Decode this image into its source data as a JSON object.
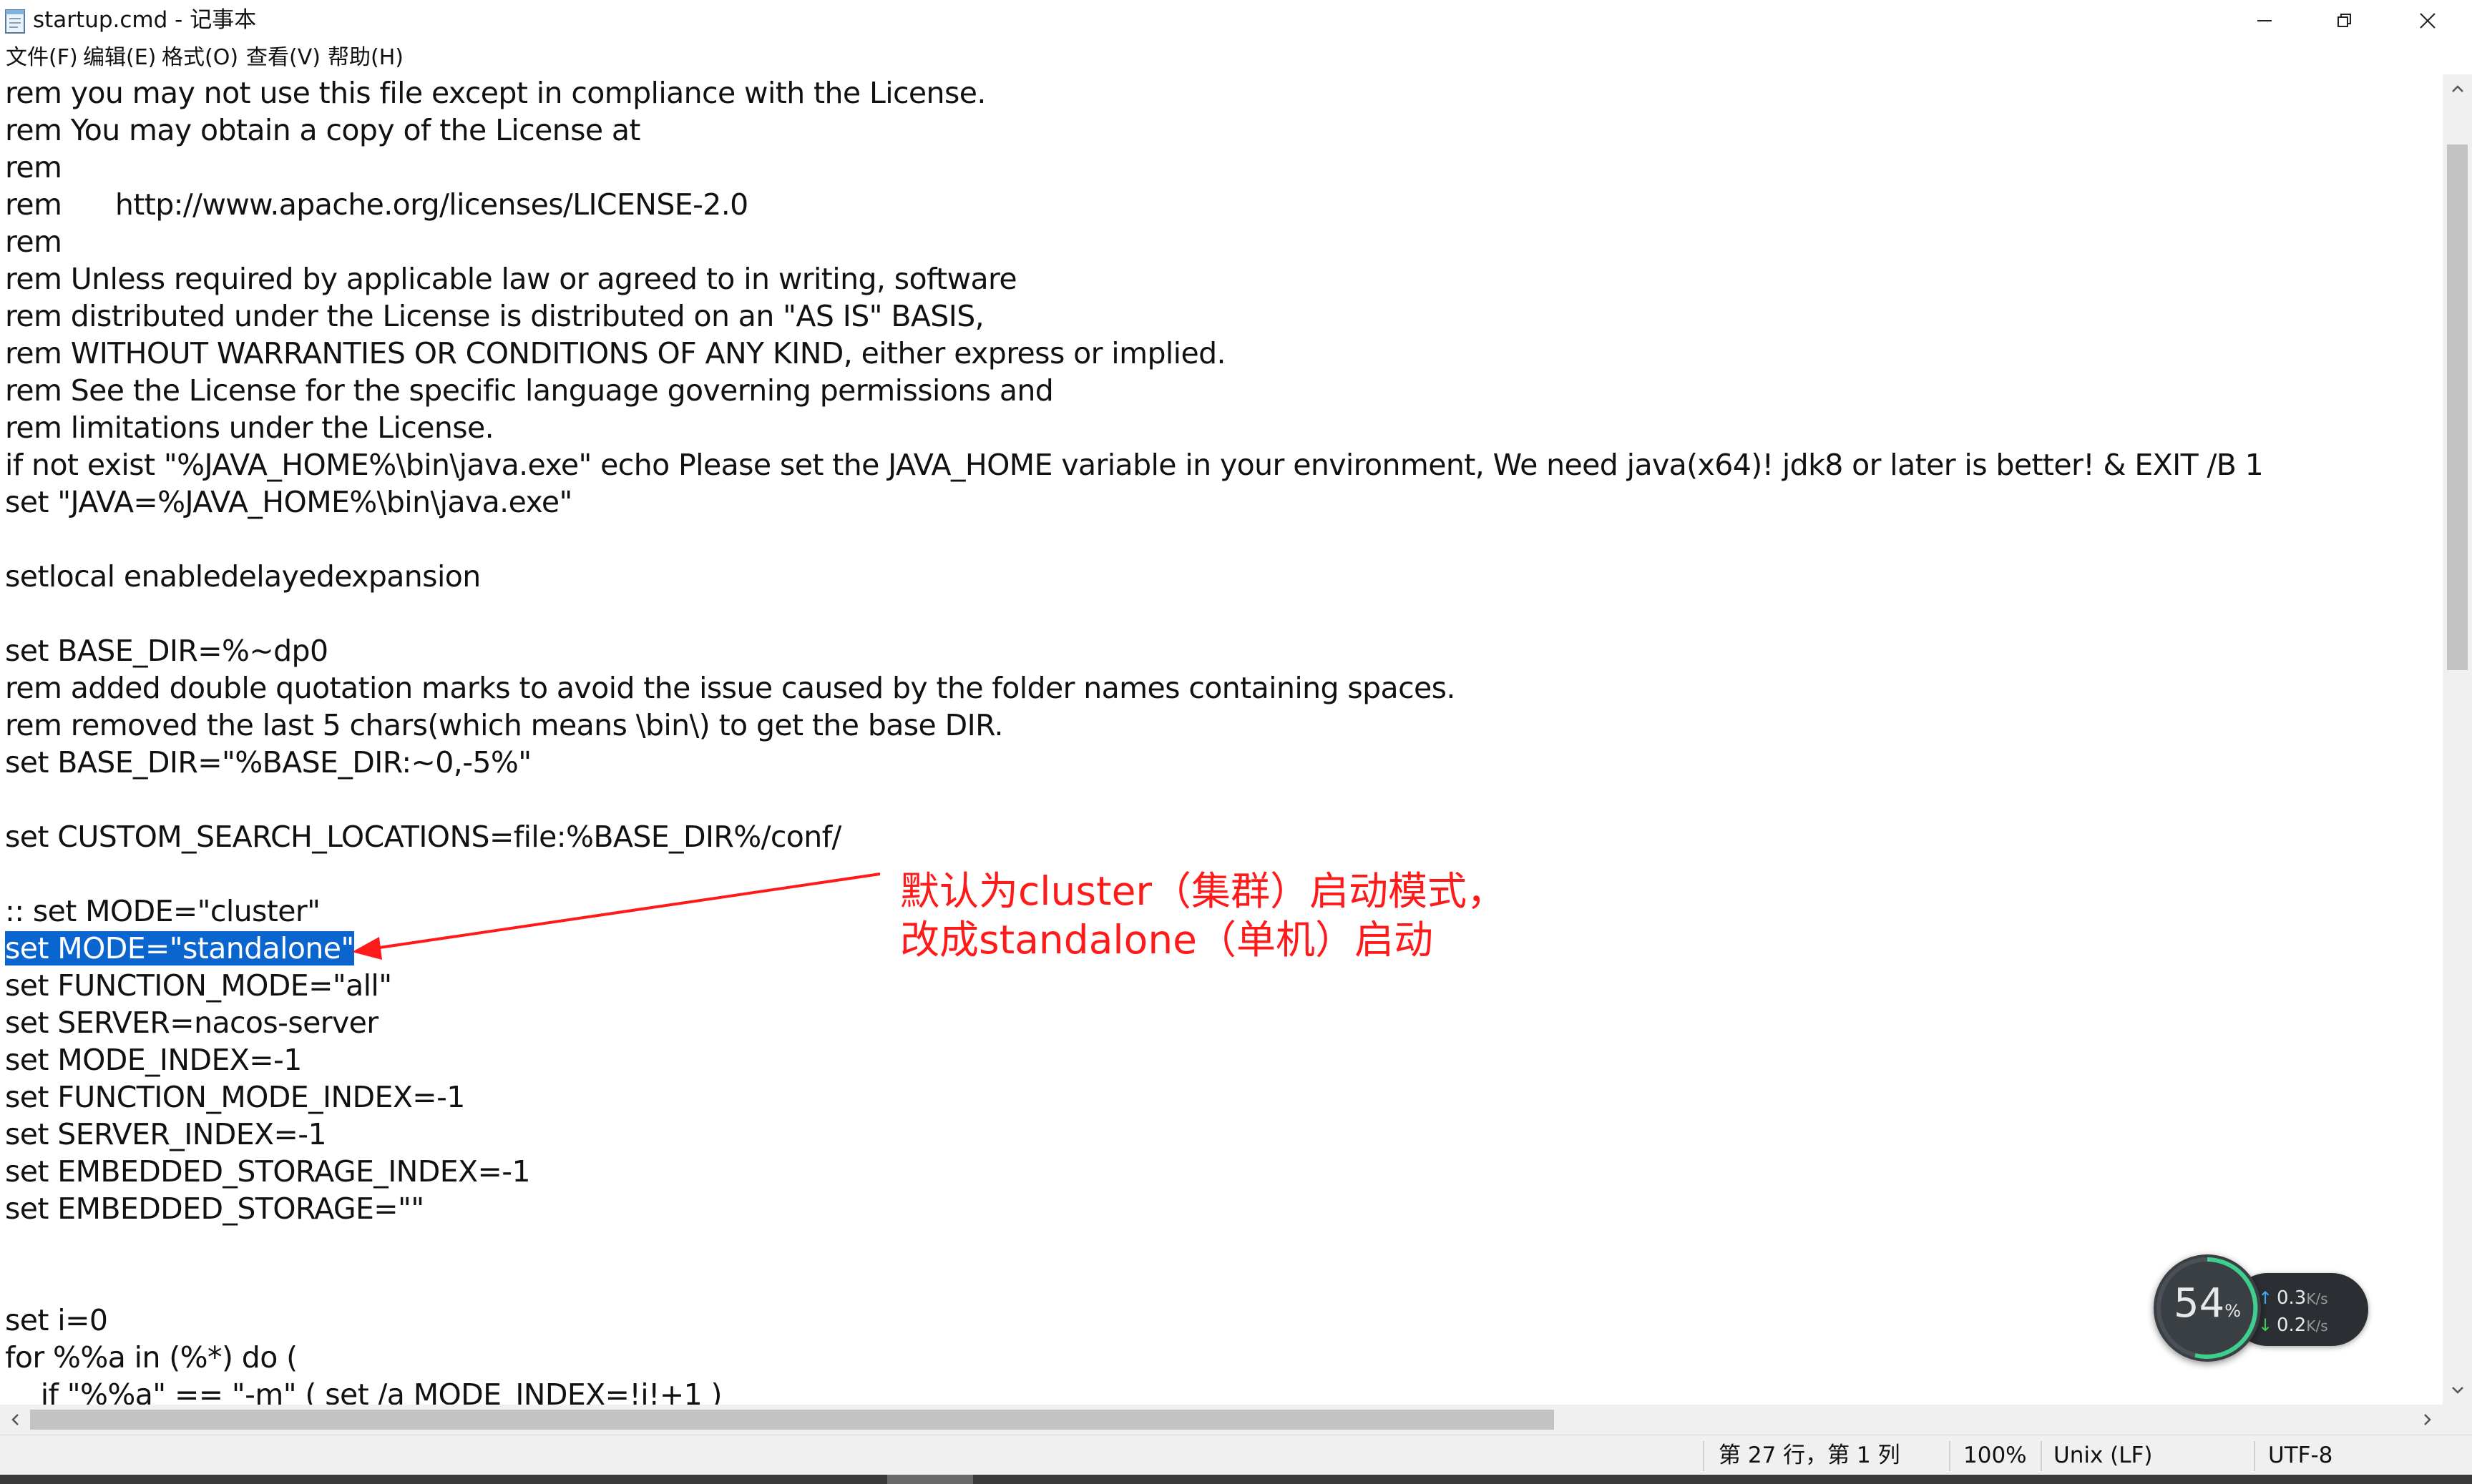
{
  "window": {
    "title": "startup.cmd - 记事本",
    "controls": {
      "minimize": "minimize",
      "restore": "restore",
      "close": "close"
    }
  },
  "menu": {
    "items": [
      "文件(F)",
      "编辑(E)",
      "格式(O)",
      "查看(V)",
      "帮助(H)"
    ]
  },
  "editor": {
    "lines": [
      "rem you may not use this file except in compliance with the License.",
      "rem You may obtain a copy of the License at",
      "rem",
      "rem      http://www.apache.org/licenses/LICENSE-2.0",
      "rem",
      "rem Unless required by applicable law or agreed to in writing, software",
      "rem distributed under the License is distributed on an \"AS IS\" BASIS,",
      "rem WITHOUT WARRANTIES OR CONDITIONS OF ANY KIND, either express or implied.",
      "rem See the License for the specific language governing permissions and",
      "rem limitations under the License.",
      "if not exist \"%JAVA_HOME%\\bin\\java.exe\" echo Please set the JAVA_HOME variable in your environment, We need java(x64)! jdk8 or later is better! & EXIT /B 1",
      "set \"JAVA=%JAVA_HOME%\\bin\\java.exe\"",
      "",
      "setlocal enabledelayedexpansion",
      "",
      "set BASE_DIR=%~dp0",
      "rem added double quotation marks to avoid the issue caused by the folder names containing spaces.",
      "rem removed the last 5 chars(which means \\bin\\) to get the base DIR.",
      "set BASE_DIR=\"%BASE_DIR:~0,-5%\"",
      "",
      "set CUSTOM_SEARCH_LOCATIONS=file:%BASE_DIR%/conf/",
      "",
      ":: set MODE=\"cluster\"",
      "set MODE=\"standalone\"",
      "set FUNCTION_MODE=\"all\"",
      "set SERVER=nacos-server",
      "set MODE_INDEX=-1",
      "set FUNCTION_MODE_INDEX=-1",
      "set SERVER_INDEX=-1",
      "set EMBEDDED_STORAGE_INDEX=-1",
      "set EMBEDDED_STORAGE=\"\"",
      "",
      "",
      "set i=0",
      "for %%a in (%*) do (",
      "    if \"%%a\" == \"-m\" ( set /a MODE_INDEX=!i!+1 )"
    ],
    "selected_line_index": 23
  },
  "annotation": {
    "line1": "默认为cluster（集群）启动模式，",
    "line2": "改成standalone（单机）启动",
    "color": "#ff1a1a"
  },
  "status": {
    "position": "第 27 行，第 1 列",
    "zoom": "100%",
    "eol": "Unix (LF)",
    "encoding": "UTF-8"
  },
  "widget": {
    "percent": "54",
    "percent_unit": "%",
    "upload": "0.3",
    "upload_unit": "K/s",
    "download": "0.2",
    "download_unit": "K/s"
  },
  "colors": {
    "selection": "#0b65cf",
    "annotation": "#ff1a1a",
    "upload_arrow": "#3fa9f5",
    "download_arrow": "#3ecf5a"
  }
}
